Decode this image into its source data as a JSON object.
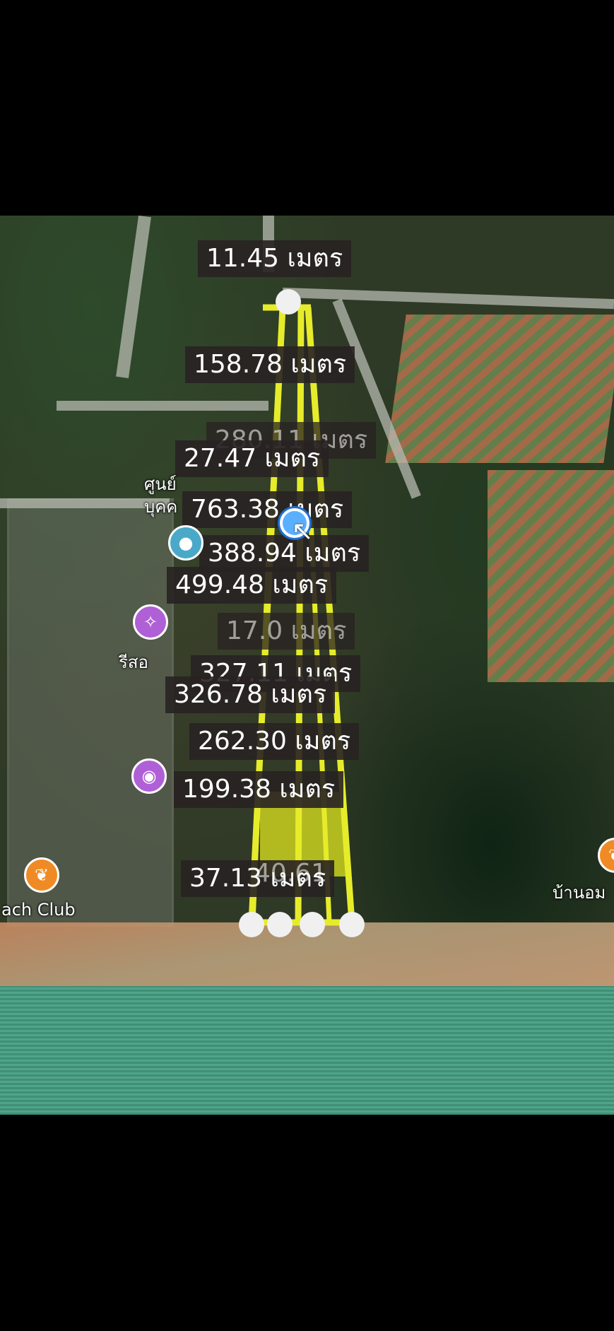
{
  "measurements": {
    "top": "11.45 เมตร",
    "m2": "158.78 เมตร",
    "m3": "280.11 เมตร",
    "m4": "27.47 เมตร",
    "m5": "763.38 เมตร",
    "m6": "388.94 เมตร",
    "m7": "499.48 เมตร",
    "m8": "17.0 เมตร",
    "m9": "327.11 เมตร",
    "m10": "326.78 เมตร",
    "m11": "262.30 เมตร",
    "m12": "199.38 เมตร",
    "m13": "37.13 เมตร",
    "m14": "40.61"
  },
  "poi": {
    "beach_club": "ach Club",
    "village": "บ้านอม",
    "center_fragment": "ศูนย์",
    "center_fragment2": "บุคค",
    "rsort_fragment": "รีสอ"
  },
  "icons": {
    "location": "location-pin-icon",
    "restaurant": "restaurant-icon",
    "photo": "photo-spot-icon",
    "cursor": "cursor-arrow-icon"
  },
  "colors": {
    "plot_line": "#e6ec2a",
    "plot_fill": "#c9d11e",
    "label_bg": "#282222",
    "restaurant_pin": "#f08a24",
    "photo_pin": "#b060d6",
    "location_pin": "#4aa9c9"
  }
}
